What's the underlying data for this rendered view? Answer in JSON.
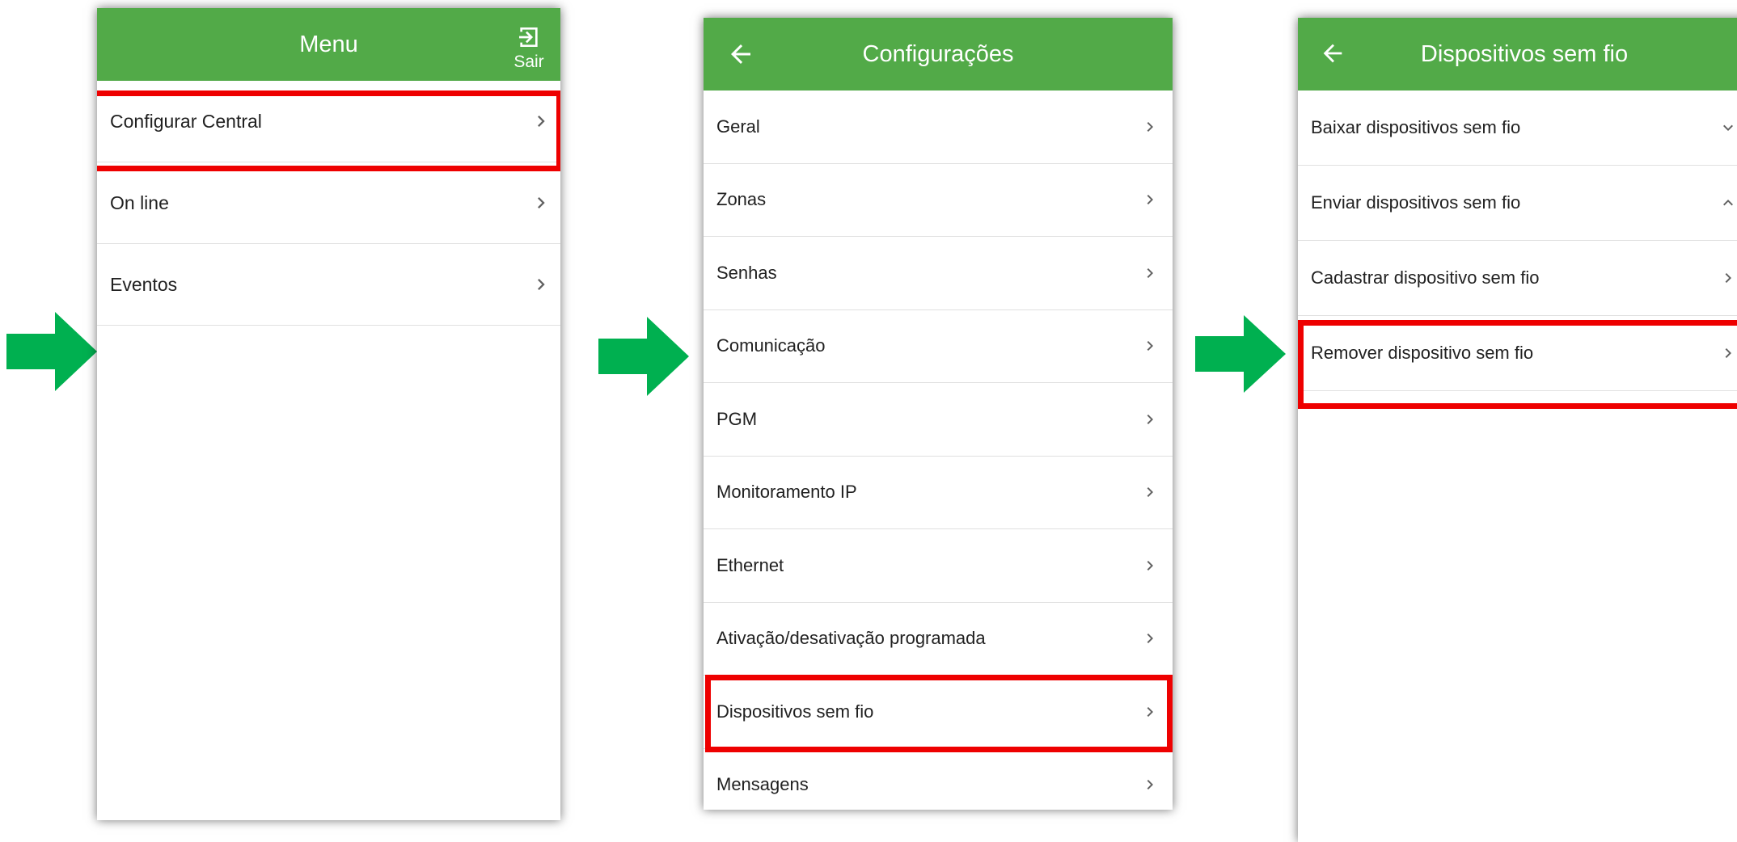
{
  "colors": {
    "appbar": "#52aa48",
    "highlight": "#ee0000",
    "arrow": "#00b050"
  },
  "screen1": {
    "title": "Menu",
    "exit_label": "Sair",
    "items": [
      {
        "label": "Configurar Central",
        "icon": "chevron-right-icon",
        "highlighted": true
      },
      {
        "label": "On line",
        "icon": "chevron-right-icon"
      },
      {
        "label": "Eventos",
        "icon": "chevron-right-icon"
      }
    ]
  },
  "screen2": {
    "title": "Configurações",
    "items": [
      {
        "label": "Geral",
        "icon": "chevron-right-icon"
      },
      {
        "label": "Zonas",
        "icon": "chevron-right-icon"
      },
      {
        "label": "Senhas",
        "icon": "chevron-right-icon"
      },
      {
        "label": "Comunicação",
        "icon": "chevron-right-icon"
      },
      {
        "label": "PGM",
        "icon": "chevron-right-icon"
      },
      {
        "label": "Monitoramento IP",
        "icon": "chevron-right-icon"
      },
      {
        "label": "Ethernet",
        "icon": "chevron-right-icon"
      },
      {
        "label": "Ativação/desativação programada",
        "icon": "chevron-right-icon"
      },
      {
        "label": "Dispositivos sem fio",
        "icon": "chevron-right-icon",
        "highlighted": true
      },
      {
        "label": "Mensagens",
        "icon": "chevron-right-icon"
      }
    ]
  },
  "screen3": {
    "title": "Dispositivos sem fio",
    "items": [
      {
        "label": "Baixar dispositivos sem fio",
        "icon": "chevron-down-icon"
      },
      {
        "label": "Enviar dispositivos sem fio",
        "icon": "chevron-up-icon"
      },
      {
        "label": "Cadastrar dispositivo sem fio",
        "icon": "chevron-right-icon"
      },
      {
        "label": "Remover dispositivo sem fio",
        "icon": "chevron-right-icon",
        "highlighted": true
      }
    ]
  }
}
